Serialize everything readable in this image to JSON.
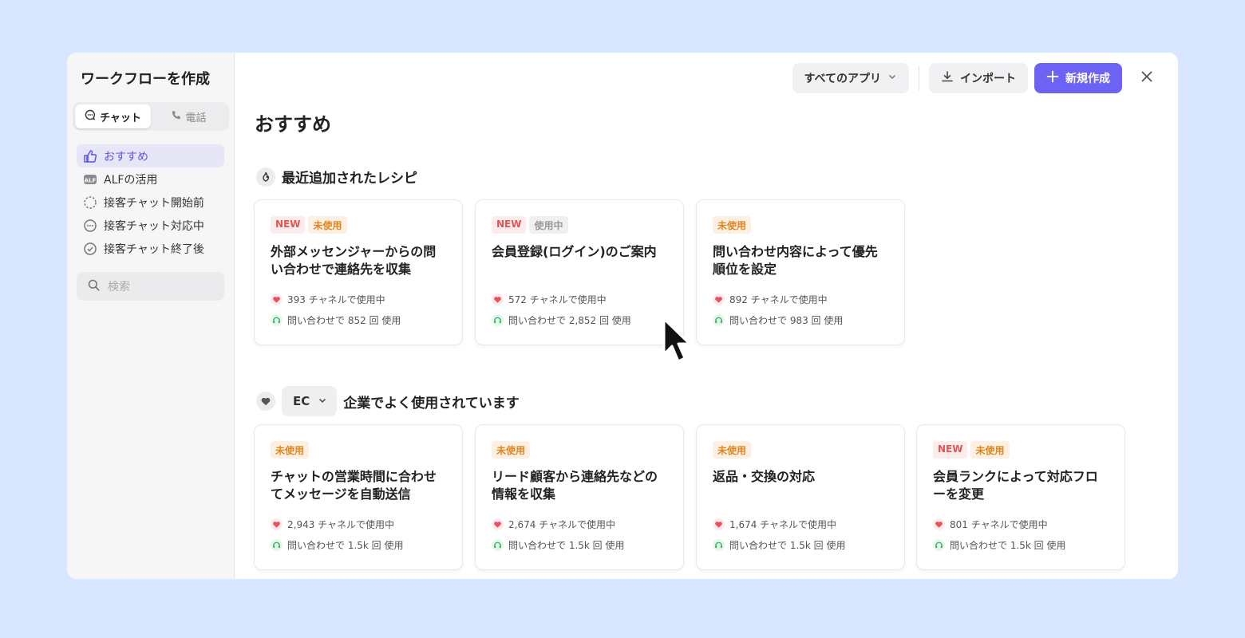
{
  "sidebar": {
    "title": "ワークフローを作成",
    "tabs": [
      {
        "label": "チャット",
        "icon": "chat-icon",
        "active": true
      },
      {
        "label": "電話",
        "icon": "phone-icon",
        "active": false
      }
    ],
    "nav": [
      {
        "label": "おすすめ",
        "icon": "thumbs-up-icon",
        "active": true
      },
      {
        "label": "ALFの活用",
        "icon": "alf-icon"
      },
      {
        "label": "接客チャット開始前",
        "icon": "dashed-circle-icon"
      },
      {
        "label": "接客チャット対応中",
        "icon": "dots-circle-icon"
      },
      {
        "label": "接客チャット終了後",
        "icon": "check-circle-icon"
      }
    ],
    "search_placeholder": "検索"
  },
  "toolbar": {
    "app_filter": "すべてのアプリ",
    "import": "インポート",
    "create_new": "新規作成"
  },
  "main": {
    "title": "おすすめ",
    "recent_section": {
      "title": "最近追加されたレシピ",
      "cards": [
        {
          "badges": [
            {
              "text": "NEW",
              "type": "new"
            },
            {
              "text": "未使用",
              "type": "unused"
            }
          ],
          "title": "外部メッセンジャーからの問い合わせで連絡先を収集",
          "channels": "393 チャネルで使用中",
          "uses": "問い合わせで 852 回 使用"
        },
        {
          "badges": [
            {
              "text": "NEW",
              "type": "new"
            },
            {
              "text": "使用中",
              "type": "used"
            }
          ],
          "title": "会員登録(ログイン)のご案内",
          "channels": "572 チャネルで使用中",
          "uses": "問い合わせで 2,852 回 使用"
        },
        {
          "badges": [
            {
              "text": "未使用",
              "type": "unused"
            }
          ],
          "title": "問い合わせ内容によって優先順位を設定",
          "channels": "892 チャネルで使用中",
          "uses": "問い合わせで 983 回 使用"
        }
      ]
    },
    "popular_section": {
      "industry": "EC",
      "title": "企業でよく使用されています",
      "cards": [
        {
          "badges": [
            {
              "text": "未使用",
              "type": "unused"
            }
          ],
          "title": "チャットの営業時間に合わせてメッセージを自動送信",
          "channels": "2,943 チャネルで使用中",
          "uses": "問い合わせで 1.5k 回 使用"
        },
        {
          "badges": [
            {
              "text": "未使用",
              "type": "unused"
            }
          ],
          "title": "リード顧客から連絡先などの情報を収集",
          "channels": "2,674 チャネルで使用中",
          "uses": "問い合わせで 1.5k 回 使用"
        },
        {
          "badges": [
            {
              "text": "未使用",
              "type": "unused"
            }
          ],
          "title": "返品・交換の対応",
          "channels": "1,674 チャネルで使用中",
          "uses": "問い合わせで 1.5k 回 使用"
        },
        {
          "badges": [
            {
              "text": "NEW",
              "type": "new"
            },
            {
              "text": "未使用",
              "type": "unused"
            }
          ],
          "title": "会員ランクによって対応フローを変更",
          "channels": "801 チャネルで使用中",
          "uses": "問い合わせで 1.5k 回 使用"
        }
      ]
    }
  },
  "colors": {
    "accent": "#6c63f5",
    "background": "#d9e6ff",
    "heart": "#e8505b",
    "headset": "#2bb35a"
  }
}
